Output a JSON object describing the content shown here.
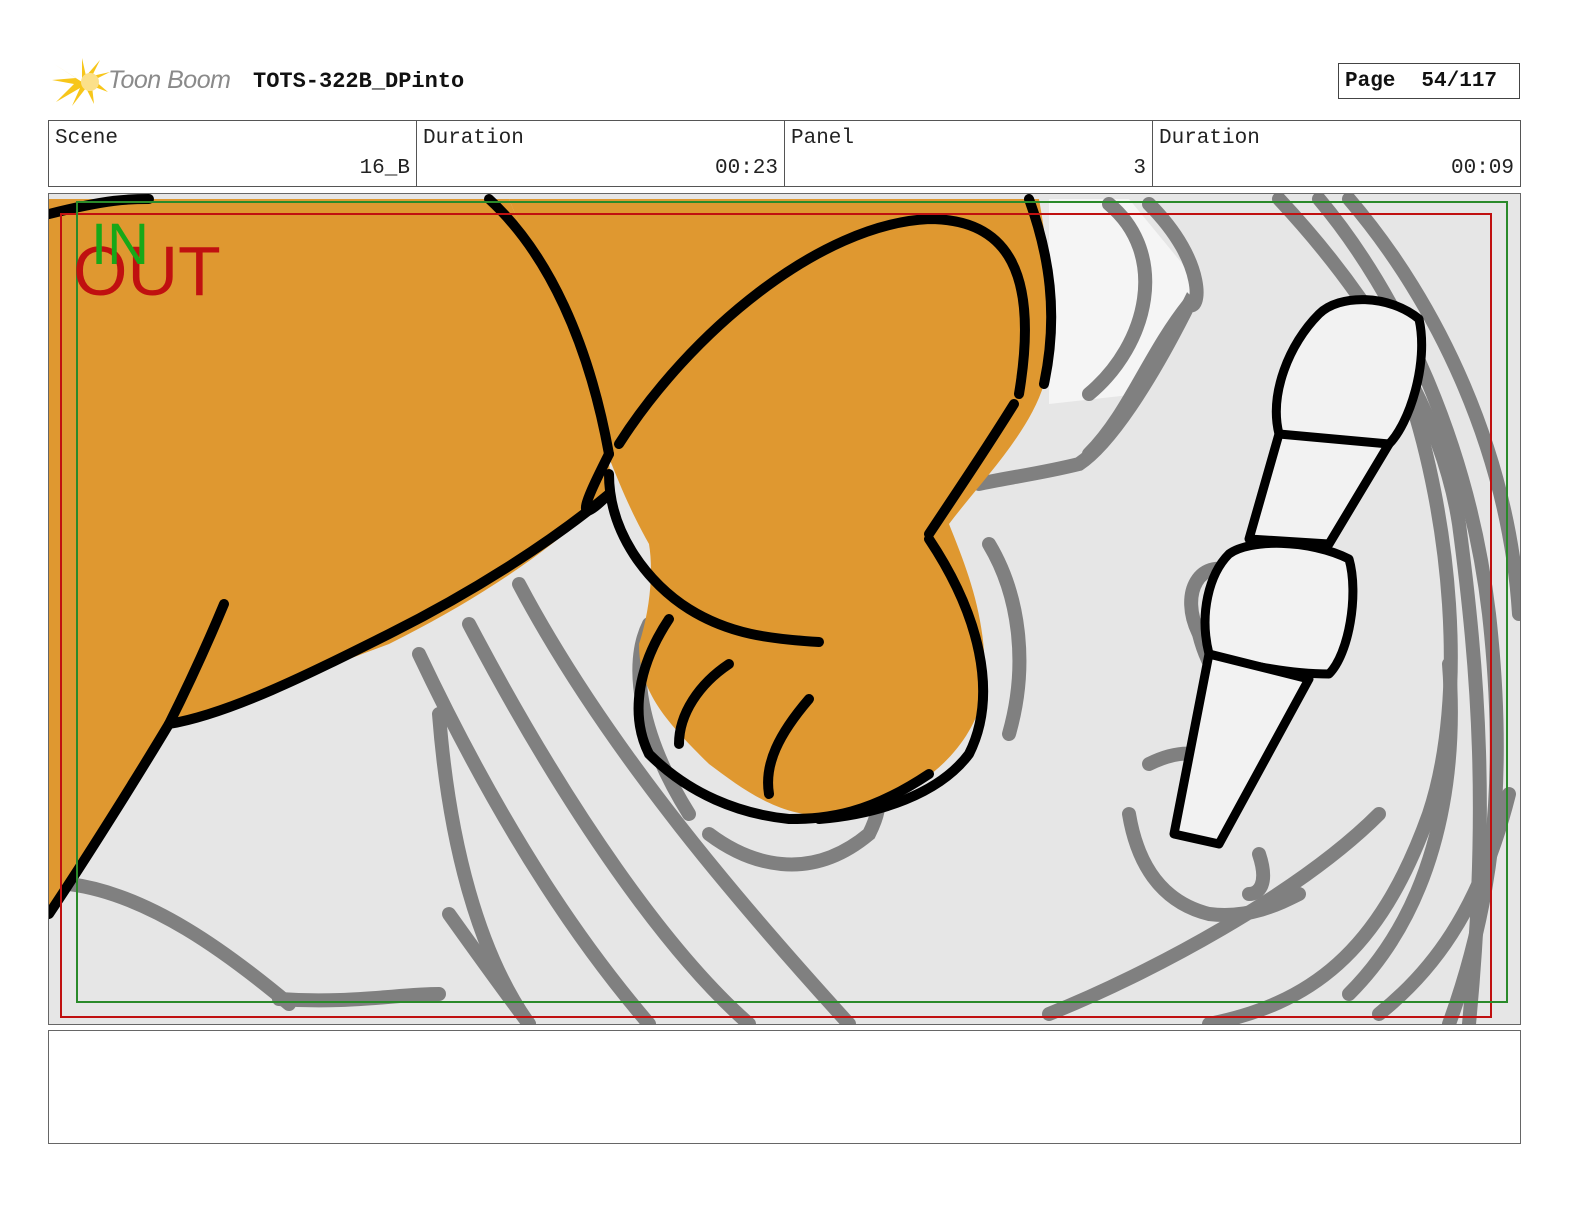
{
  "header": {
    "logo_text": "Toon Boom",
    "project_title": "TOTS-322B_DPinto",
    "page_label": "Page",
    "page_value": "54/117"
  },
  "info_bar": {
    "scene_label": "Scene",
    "scene_value": "16_B",
    "scene_duration_label": "Duration",
    "scene_duration_value": "00:23",
    "panel_label": "Panel",
    "panel_value": "3",
    "panel_duration_label": "Duration",
    "panel_duration_value": "00:09"
  },
  "panel": {
    "in_marker": "IN",
    "out_marker": "OUT",
    "in_frame_color": "#2a8a2a",
    "out_frame_color": "#c01010",
    "fur_color": "#df9830",
    "sketch_color": "#808080"
  },
  "notes": {
    "text": ""
  }
}
